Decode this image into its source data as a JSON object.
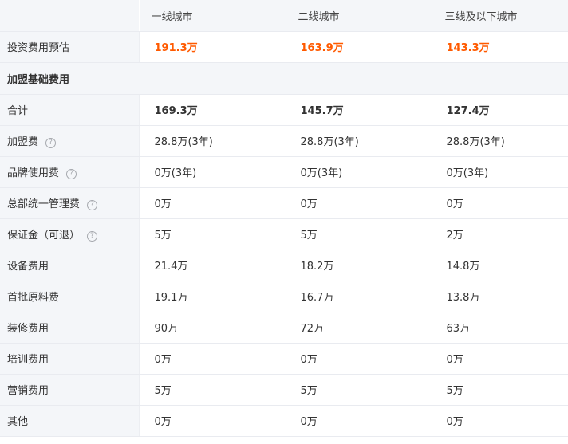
{
  "columns": [
    "一线城市",
    "二线城市",
    "三线及以下城市"
  ],
  "invest": {
    "label": "投资费用预估",
    "values": [
      "191.3万",
      "163.9万",
      "143.3万"
    ]
  },
  "section_label": "加盟基础费用",
  "rows": [
    {
      "label": "合计",
      "values": [
        "169.3万",
        "145.7万",
        "127.4万"
      ]
    },
    {
      "label": "加盟费",
      "help_icon": "question-circle",
      "values": [
        "28.8万(3年)",
        "28.8万(3年)",
        "28.8万(3年)"
      ]
    },
    {
      "label": "品牌使用费",
      "help_icon": "question-circle",
      "values": [
        "0万(3年)",
        "0万(3年)",
        "0万(3年)"
      ]
    },
    {
      "label": "总部统一管理费",
      "help_icon": "question-circle",
      "values": [
        "0万",
        "0万",
        "0万"
      ]
    },
    {
      "label": "保证金（可退）",
      "help_icon": "question-circle",
      "values": [
        "5万",
        "5万",
        "2万"
      ]
    },
    {
      "label": "设备费用",
      "values": [
        "21.4万",
        "18.2万",
        "14.8万"
      ]
    },
    {
      "label": "首批原料费",
      "values": [
        "19.1万",
        "16.7万",
        "13.8万"
      ]
    },
    {
      "label": "装修费用",
      "values": [
        "90万",
        "72万",
        "63万"
      ]
    },
    {
      "label": "培训费用",
      "values": [
        "0万",
        "0万",
        "0万"
      ]
    },
    {
      "label": "营销费用",
      "values": [
        "5万",
        "5万",
        "5万"
      ]
    },
    {
      "label": "其他",
      "values": [
        "0万",
        "0万",
        "0万"
      ]
    }
  ],
  "help_glyph": "?",
  "colors": {
    "accent": "#ff5a00",
    "label_bg": "#f4f6f9",
    "border": "#e9ebf0"
  }
}
